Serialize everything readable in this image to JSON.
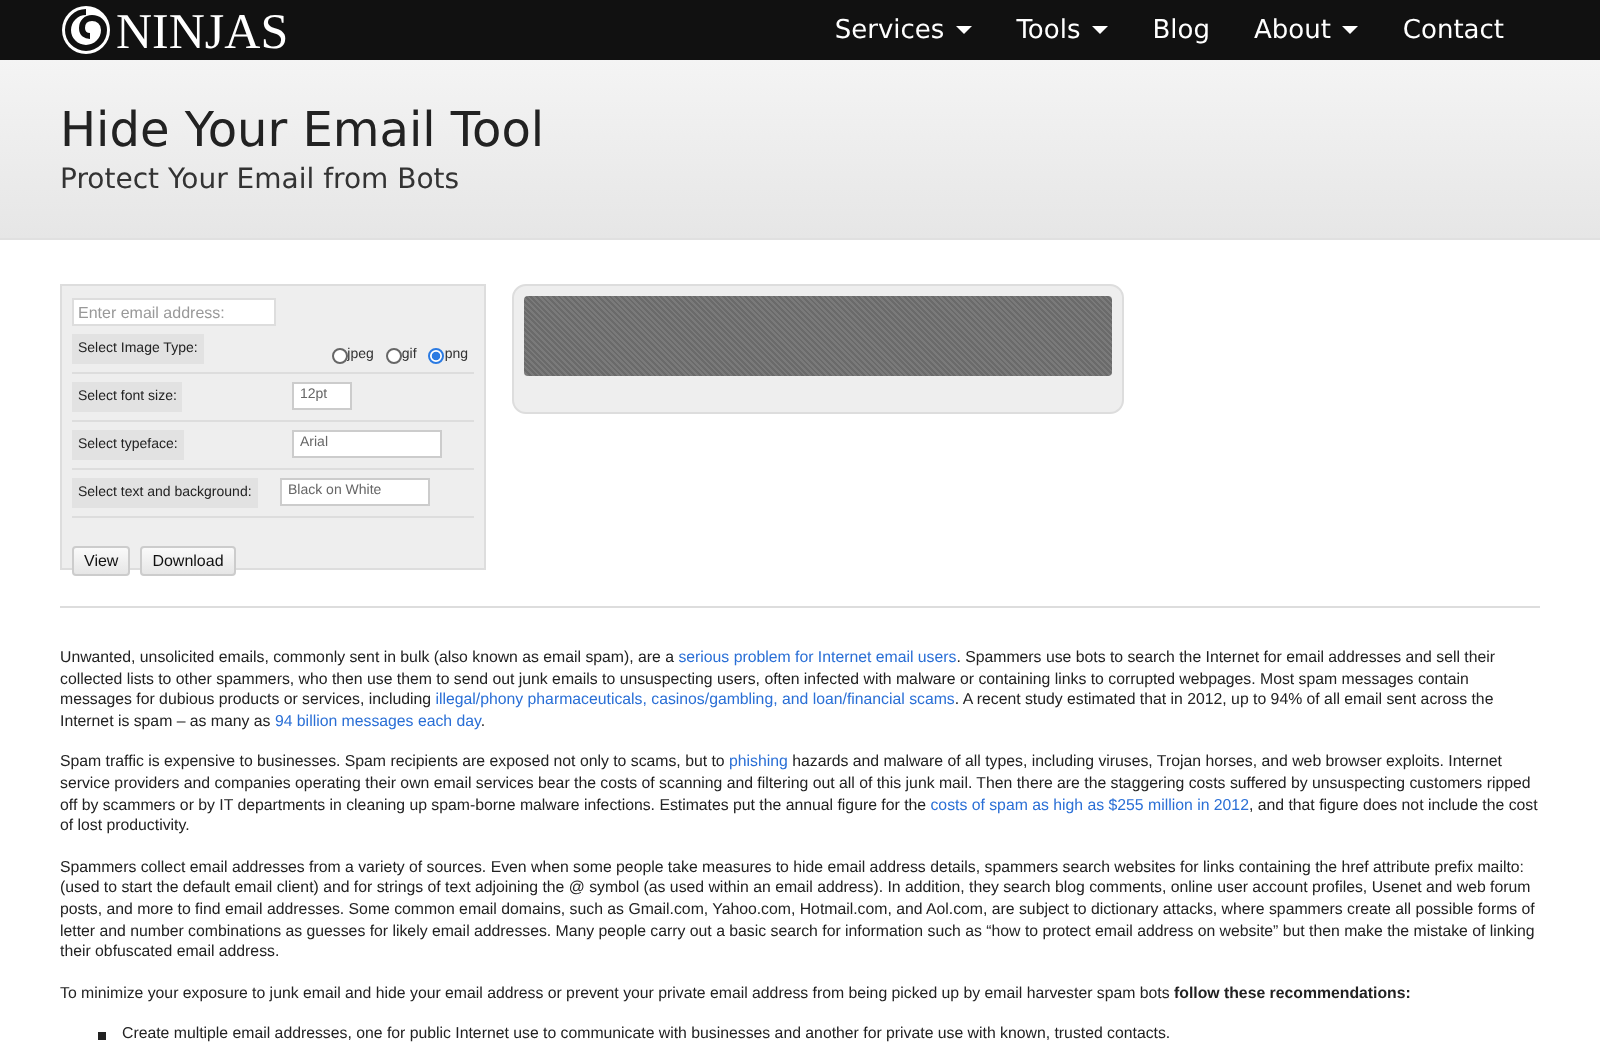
{
  "nav": {
    "logo": "NINJAS",
    "items": [
      {
        "label": "Services",
        "dropdown": true
      },
      {
        "label": "Tools",
        "dropdown": true
      },
      {
        "label": "Blog",
        "dropdown": false
      },
      {
        "label": "About",
        "dropdown": true
      },
      {
        "label": "Contact",
        "dropdown": false
      }
    ]
  },
  "hero": {
    "title": "Hide Your Email Tool",
    "subtitle": "Protect Your Email from Bots"
  },
  "form": {
    "email_placeholder": "Enter email address:",
    "rows": [
      {
        "kind": "radio",
        "label": "Select Image Type:",
        "options": [
          {
            "label": "jpeg",
            "selected": false
          },
          {
            "label": "gif",
            "selected": false
          },
          {
            "label": "png",
            "selected": true
          }
        ]
      },
      {
        "kind": "field",
        "label": "Select font size:",
        "value": "12pt"
      },
      {
        "kind": "field",
        "label": "Select typeface:",
        "value": "Arial"
      },
      {
        "kind": "field",
        "label": "Select text and background:",
        "value": "Black on White"
      }
    ],
    "buttons": [
      "View",
      "Download"
    ]
  },
  "article": {
    "paragraphs": [
      [
        {
          "text": "Unwanted, unsolicited emails, commonly sent in bulk (also known as email spam), are a ",
          "link": false
        },
        {
          "text": "serious problem for Internet email users",
          "link": true
        },
        {
          "text": ". Spammers use bots to search the Internet for email addresses and sell their collected lists to other spammers, who then use them to send out junk emails to unsuspecting users, often infected with malware or containing links to corrupted webpages. Most spam messages contain messages for dubious products or services, including ",
          "link": false
        },
        {
          "text": "illegal/phony pharmaceuticals, casinos/gambling, and loan/financial scams",
          "link": true
        },
        {
          "text": ". A recent study estimated that in 2012, up to 94% of all email sent across the Internet is spam – as many as ",
          "link": false
        },
        {
          "text": "94 billion messages each day",
          "link": true
        },
        {
          "text": ".",
          "link": false
        }
      ],
      [
        {
          "text": "Spam traffic is expensive to businesses. Spam recipients are exposed not only to scams, but to ",
          "link": false
        },
        {
          "text": "phishing",
          "link": true
        },
        {
          "text": " hazards and malware of all types, including viruses, Trojan horses, and web browser exploits. Internet service providers and companies operating their own email services bear the costs of scanning and filtering out all of this junk mail. Then there are the staggering costs suffered by unsuspecting customers ripped off by scammers or by IT departments in cleaning up spam-borne malware infections. Estimates put the annual figure for the ",
          "link": false
        },
        {
          "text": "costs of spam as high as $255 million in 2012",
          "link": true
        },
        {
          "text": ", and that figure does not include the cost of lost productivity.",
          "link": false
        }
      ],
      [
        {
          "text": "Spammers collect email addresses from a variety of sources. Even when some people take measures to hide email address details, spammers search websites for links containing the href attribute prefix mailto: (used to start the default email client) and for strings of text adjoining the @ symbol (as used within an email address). In addition, they search blog comments, online user account profiles, Usenet and web forum posts, and more to find email addresses. Some common email domains, such as Gmail.com, Yahoo.com, Hotmail.com, and Aol.com, are subject to dictionary attacks, where spammers create all possible forms of letter and number combinations as guesses for likely email addresses. Many people carry out a basic search for information such as “how to protect email address on website” but then make the mistake of linking their obfuscated email address.",
          "link": false
        }
      ],
      [
        {
          "text": "To minimize your exposure to junk email and hide your email address or prevent your private email address from being picked up by email harvester spam bots **follow these recommendations:**",
          "link": false
        }
      ]
    ],
    "bullets": [
      "Create multiple email addresses, one for public Internet use to communicate with businesses and another for private use with known, trusted contacts."
    ]
  }
}
